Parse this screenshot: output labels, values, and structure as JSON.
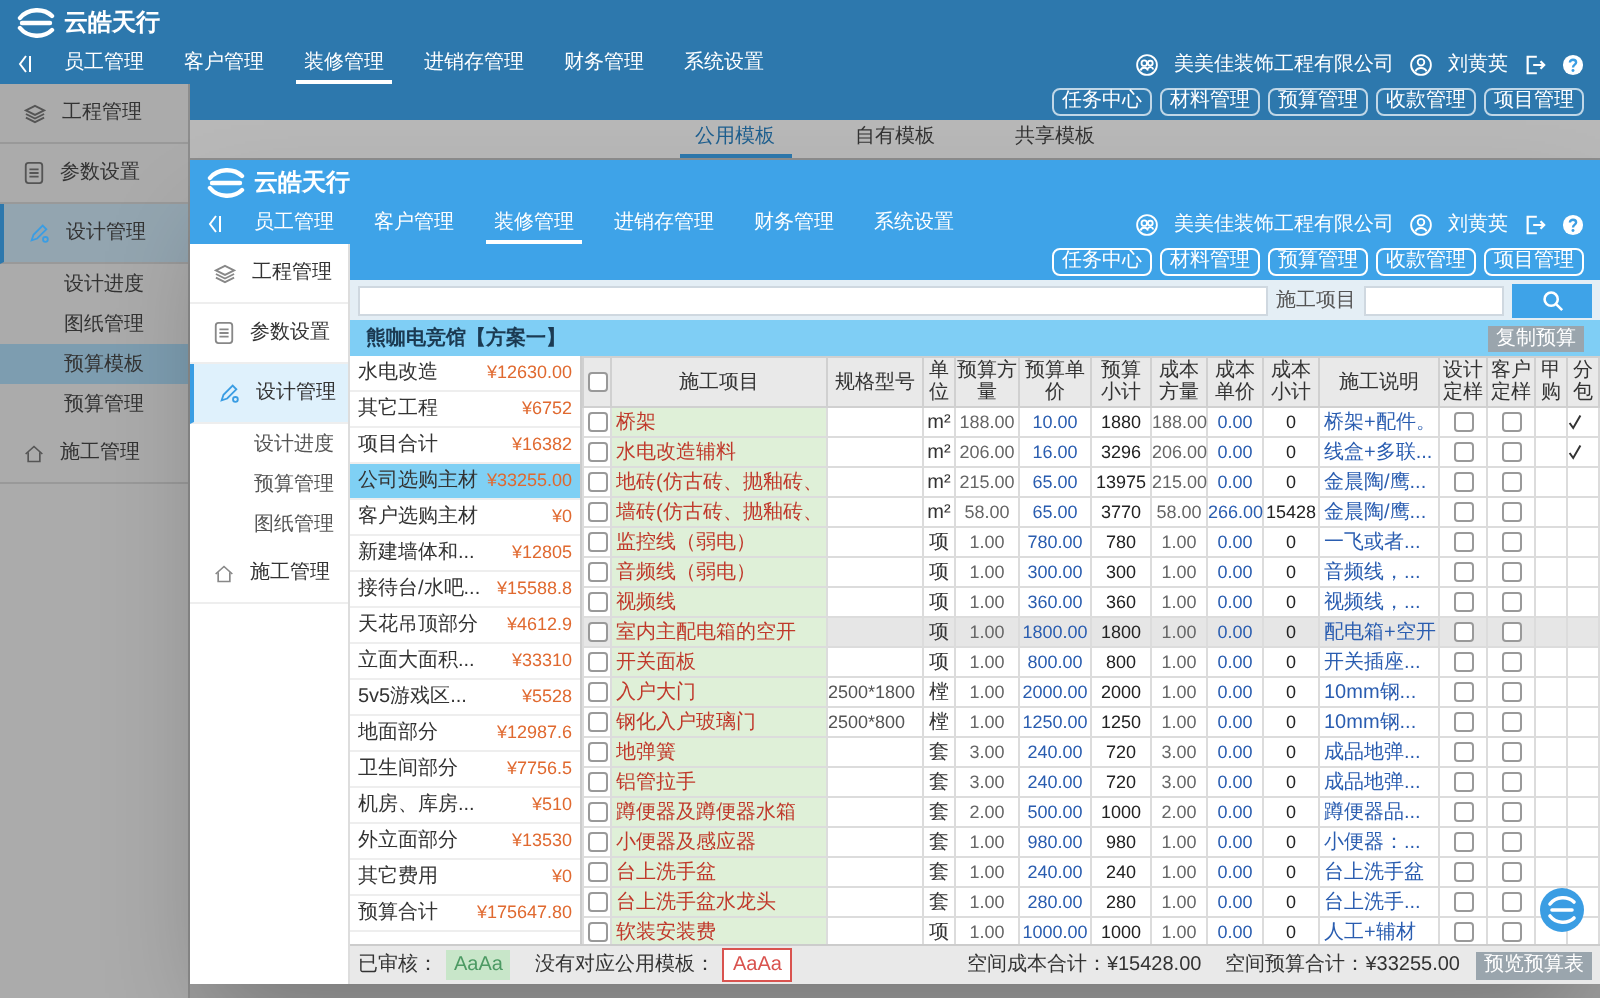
{
  "back_window": {
    "logo": "云皓天行",
    "nav": [
      {
        "label": "员工管理",
        "selected": false
      },
      {
        "label": "客户管理",
        "selected": false
      },
      {
        "label": "装修管理",
        "selected": true
      },
      {
        "label": "进销存管理",
        "selected": false
      },
      {
        "label": "财务管理",
        "selected": false
      },
      {
        "label": "系统设置",
        "selected": false
      }
    ],
    "company": "美美佳装饰工程有限公司",
    "user": "刘黄英",
    "toolbar_buttons": [
      "任务中心",
      "材料管理",
      "预算管理",
      "收款管理",
      "项目管理"
    ],
    "tabs": [
      {
        "label": "公用模板",
        "selected": true
      },
      {
        "label": "自有模板",
        "selected": false
      },
      {
        "label": "共享模板",
        "selected": false
      }
    ],
    "sidebar": [
      {
        "label": "工程管理",
        "selected": false
      },
      {
        "label": "参数设置",
        "selected": false
      },
      {
        "label": "设计管理",
        "selected": true,
        "children": [
          {
            "label": "设计进度",
            "selected": false
          },
          {
            "label": "图纸管理",
            "selected": false
          },
          {
            "label": "预算模板",
            "selected": true
          },
          {
            "label": "预算管理",
            "selected": false
          }
        ]
      },
      {
        "label": "施工管理",
        "selected": false
      }
    ]
  },
  "front_window": {
    "logo": "云皓天行",
    "nav": [
      {
        "label": "员工管理",
        "selected": false
      },
      {
        "label": "客户管理",
        "selected": false
      },
      {
        "label": "装修管理",
        "selected": true
      },
      {
        "label": "进销存管理",
        "selected": false
      },
      {
        "label": "财务管理",
        "selected": false
      },
      {
        "label": "系统设置",
        "selected": false
      }
    ],
    "company": "美美佳装饰工程有限公司",
    "user": "刘黄英",
    "toolbar_buttons": [
      "任务中心",
      "材料管理",
      "预算管理",
      "收款管理",
      "项目管理"
    ],
    "sidebar": [
      {
        "label": "工程管理",
        "selected": false
      },
      {
        "label": "参数设置",
        "selected": false
      },
      {
        "label": "设计管理",
        "selected": true,
        "children": [
          {
            "label": "设计进度",
            "selected": false
          },
          {
            "label": "预算管理",
            "selected": false
          },
          {
            "label": "图纸管理",
            "selected": false
          }
        ]
      },
      {
        "label": "施工管理",
        "selected": false
      }
    ],
    "search_label": "施工项目",
    "project_title": "熊咖电竞馆【方案一】",
    "copy_button": "复制预算",
    "categories": [
      {
        "name": "水电改造",
        "amount": "¥12630.00",
        "selected": false
      },
      {
        "name": "其它工程",
        "amount": "¥6752",
        "selected": false
      },
      {
        "name": "项目合计",
        "amount": "¥16382",
        "selected": false
      },
      {
        "name": "公司选购主材",
        "amount": "¥33255.00",
        "selected": true
      },
      {
        "name": "客户选购主材",
        "amount": "¥0",
        "selected": false
      },
      {
        "name": "新建墙体和...",
        "amount": "¥12805",
        "selected": false
      },
      {
        "name": "接待台/水吧...",
        "amount": "¥15588.8",
        "selected": false
      },
      {
        "name": "天花吊顶部分",
        "amount": "¥4612.9",
        "selected": false
      },
      {
        "name": "立面大面积...",
        "amount": "¥33310",
        "selected": false
      },
      {
        "name": "5v5游戏区...",
        "amount": "¥5528",
        "selected": false
      },
      {
        "name": "地面部分",
        "amount": "¥12987.6",
        "selected": false
      },
      {
        "name": "卫生间部分",
        "amount": "¥7756.5",
        "selected": false
      },
      {
        "name": "机房、库房...",
        "amount": "¥510",
        "selected": false
      },
      {
        "name": "外立面部分",
        "amount": "¥13530",
        "selected": false
      },
      {
        "name": "其它费用",
        "amount": "¥0",
        "selected": false
      },
      {
        "name": "预算合计",
        "amount": "¥175647.80",
        "selected": false
      }
    ],
    "table": {
      "select_all_checked": false,
      "columns": [
        "施工项目",
        "规格型号",
        "单位",
        "预算方量",
        "预算单价",
        "预算小计",
        "成本方量",
        "成本单价",
        "成本小计",
        "施工说明",
        "设计定样",
        "客户定样",
        "甲购",
        "分包"
      ],
      "rows": [
        {
          "item": "桥架",
          "unit": "m²",
          "budget_qty": "188.00",
          "budget_price": "10.00",
          "budget_subtotal": "1880",
          "cost_qty": "188.00",
          "cost_price": "0.00",
          "cost_subtotal": "0",
          "note": "桥架+配件。",
          "checked": false,
          "design_sample": false,
          "customer_sample": false,
          "subcontract": true,
          "highlighted": false
        },
        {
          "item": "水电改造辅料",
          "unit": "m²",
          "budget_qty": "206.00",
          "budget_price": "16.00",
          "budget_subtotal": "3296",
          "cost_qty": "206.00",
          "cost_price": "0.00",
          "cost_subtotal": "0",
          "note": "线盒+多联...",
          "checked": false,
          "design_sample": false,
          "customer_sample": false,
          "subcontract": true,
          "highlighted": false
        },
        {
          "item": "地砖(仿古砖、抛釉砖、",
          "unit": "m²",
          "budget_qty": "215.00",
          "budget_price": "65.00",
          "budget_subtotal": "13975",
          "cost_qty": "215.00",
          "cost_price": "0.00",
          "cost_subtotal": "0",
          "note": "金晨陶/鹰...",
          "checked": false,
          "design_sample": false,
          "customer_sample": false,
          "subcontract": false,
          "highlighted": false
        },
        {
          "item": "墙砖(仿古砖、抛釉砖、",
          "unit": "m²",
          "budget_qty": "58.00",
          "budget_price": "65.00",
          "budget_subtotal": "3770",
          "cost_qty": "58.00",
          "cost_price": "266.00",
          "cost_subtotal": "15428",
          "note": "金晨陶/鹰...",
          "checked": false,
          "design_sample": false,
          "customer_sample": false,
          "subcontract": false,
          "highlighted": false
        },
        {
          "item": "监控线（弱电）",
          "unit": "项",
          "budget_qty": "1.00",
          "budget_price": "780.00",
          "budget_subtotal": "780",
          "cost_qty": "1.00",
          "cost_price": "0.00",
          "cost_subtotal": "0",
          "note": "一飞或者...",
          "checked": false,
          "design_sample": false,
          "customer_sample": false,
          "subcontract": false,
          "highlighted": false
        },
        {
          "item": "音频线（弱电）",
          "unit": "项",
          "budget_qty": "1.00",
          "budget_price": "300.00",
          "budget_subtotal": "300",
          "cost_qty": "1.00",
          "cost_price": "0.00",
          "cost_subtotal": "0",
          "note": "音频线，...",
          "checked": false,
          "design_sample": false,
          "customer_sample": false,
          "subcontract": false,
          "highlighted": false
        },
        {
          "item": "视频线",
          "unit": "项",
          "budget_qty": "1.00",
          "budget_price": "360.00",
          "budget_subtotal": "360",
          "cost_qty": "1.00",
          "cost_price": "0.00",
          "cost_subtotal": "0",
          "note": "视频线，...",
          "checked": false,
          "design_sample": false,
          "customer_sample": false,
          "subcontract": false,
          "highlighted": false
        },
        {
          "item": "室内主配电箱的空开",
          "unit": "项",
          "budget_qty": "1.00",
          "budget_price": "1800.00",
          "budget_subtotal": "1800",
          "cost_qty": "1.00",
          "cost_price": "0.00",
          "cost_subtotal": "0",
          "note": "配电箱+空开",
          "checked": false,
          "design_sample": false,
          "customer_sample": false,
          "subcontract": false,
          "highlighted": true
        },
        {
          "item": "开关面板",
          "unit": "项",
          "budget_qty": "1.00",
          "budget_price": "800.00",
          "budget_subtotal": "800",
          "cost_qty": "1.00",
          "cost_price": "0.00",
          "cost_subtotal": "0",
          "note": "开关插座...",
          "checked": false,
          "design_sample": false,
          "customer_sample": false,
          "subcontract": false,
          "highlighted": false
        },
        {
          "item": "入户大门",
          "spec": "2500*1800",
          "unit": "樘",
          "budget_qty": "1.00",
          "budget_price": "2000.00",
          "budget_subtotal": "2000",
          "cost_qty": "1.00",
          "cost_price": "0.00",
          "cost_subtotal": "0",
          "note": "10mm钢...",
          "checked": false,
          "design_sample": false,
          "customer_sample": false,
          "subcontract": false,
          "highlighted": false
        },
        {
          "item": "钢化入户玻璃门",
          "spec": "2500*800",
          "unit": "樘",
          "budget_qty": "1.00",
          "budget_price": "1250.00",
          "budget_subtotal": "1250",
          "cost_qty": "1.00",
          "cost_price": "0.00",
          "cost_subtotal": "0",
          "note": "10mm钢...",
          "checked": false,
          "design_sample": false,
          "customer_sample": false,
          "subcontract": false,
          "highlighted": false
        },
        {
          "item": "地弹簧",
          "unit": "套",
          "budget_qty": "3.00",
          "budget_price": "240.00",
          "budget_subtotal": "720",
          "cost_qty": "3.00",
          "cost_price": "0.00",
          "cost_subtotal": "0",
          "note": "成品地弹...",
          "checked": false,
          "design_sample": false,
          "customer_sample": false,
          "subcontract": false,
          "highlighted": false
        },
        {
          "item": "铝管拉手",
          "unit": "套",
          "budget_qty": "3.00",
          "budget_price": "240.00",
          "budget_subtotal": "720",
          "cost_qty": "3.00",
          "cost_price": "0.00",
          "cost_subtotal": "0",
          "note": "成品地弹...",
          "checked": false,
          "design_sample": false,
          "customer_sample": false,
          "subcontract": false,
          "highlighted": false
        },
        {
          "item": "蹲便器及蹲便器水箱",
          "unit": "套",
          "budget_qty": "2.00",
          "budget_price": "500.00",
          "budget_subtotal": "1000",
          "cost_qty": "2.00",
          "cost_price": "0.00",
          "cost_subtotal": "0",
          "note": "蹲便器品...",
          "checked": false,
          "design_sample": false,
          "customer_sample": false,
          "subcontract": false,
          "highlighted": false
        },
        {
          "item": "小便器及感应器",
          "unit": "套",
          "budget_qty": "1.00",
          "budget_price": "980.00",
          "budget_subtotal": "980",
          "cost_qty": "1.00",
          "cost_price": "0.00",
          "cost_subtotal": "0",
          "note": "小便器：...",
          "checked": false,
          "design_sample": false,
          "customer_sample": false,
          "subcontract": false,
          "highlighted": false
        },
        {
          "item": "台上洗手盆",
          "unit": "套",
          "budget_qty": "1.00",
          "budget_price": "240.00",
          "budget_subtotal": "240",
          "cost_qty": "1.00",
          "cost_price": "0.00",
          "cost_subtotal": "0",
          "note": "台上洗手盆",
          "checked": false,
          "design_sample": false,
          "customer_sample": false,
          "subcontract": false,
          "highlighted": false
        },
        {
          "item": "台上洗手盆水龙头",
          "unit": "套",
          "budget_qty": "1.00",
          "budget_price": "280.00",
          "budget_subtotal": "280",
          "cost_qty": "1.00",
          "cost_price": "0.00",
          "cost_subtotal": "0",
          "note": "台上洗手...",
          "checked": false,
          "design_sample": false,
          "customer_sample": false,
          "subcontract": false,
          "highlighted": false
        },
        {
          "item": "软装安装费",
          "unit": "项",
          "budget_qty": "1.00",
          "budget_price": "1000.00",
          "budget_subtotal": "1000",
          "cost_qty": "1.00",
          "cost_price": "0.00",
          "cost_subtotal": "0",
          "note": "人工+辅材",
          "checked": false,
          "design_sample": false,
          "customer_sample": false,
          "subcontract": false,
          "highlighted": false
        }
      ]
    },
    "footer": {
      "approved_label": "已审核：",
      "approved_sample": "AaAa",
      "no_template_label": "没有对应公用模板：",
      "no_template_sample": "AaAa",
      "cost_total": "空间成本合计：¥15428.00",
      "budget_total": "空间预算合计：¥33255.00",
      "preview_button": "预览预算表"
    }
  }
}
